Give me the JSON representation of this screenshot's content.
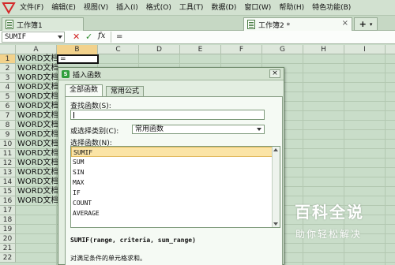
{
  "menubar": {
    "app_icon": "wps-spreadsheet-logo",
    "items": [
      "文件(F)",
      "编辑(E)",
      "视图(V)",
      "插入(I)",
      "格式(O)",
      "工具(T)",
      "数据(D)",
      "窗口(W)",
      "帮助(H)",
      "特色功能(B)"
    ]
  },
  "tabs": [
    {
      "label": "工作簿1",
      "active": false
    },
    {
      "label": "工作簿2 *",
      "active": true
    }
  ],
  "add_tab": {
    "label": "+"
  },
  "formula_bar": {
    "name_box": "SUMIF",
    "cancel": "✕",
    "enter": "✓",
    "fx": "fx",
    "content": "="
  },
  "grid": {
    "columns": [
      "A",
      "B",
      "C",
      "D",
      "E",
      "F",
      "G",
      "H",
      "I"
    ],
    "rows": [
      "1",
      "2",
      "3",
      "4",
      "5",
      "6",
      "7",
      "8",
      "9",
      "10",
      "11",
      "12",
      "13",
      "14",
      "15",
      "16",
      "17",
      "18",
      "19",
      "20",
      "21",
      "22"
    ],
    "column_a_values": [
      "WORD文档",
      "WORD文档",
      "WORD文档",
      "WORD文档",
      "WORD文档",
      "WORD文档",
      "WORD文档",
      "WORD文档",
      "WORD文档",
      "WORD文档",
      "WORD文档",
      "WORD文档",
      "WORD文档",
      "WORD文档",
      "WORD文档",
      "WORD文档"
    ],
    "active_cell_content": "="
  },
  "dialog": {
    "title": "插入函数",
    "close": "×",
    "tabs": [
      "全部函数",
      "常用公式"
    ],
    "search_label": "查找函数(S):",
    "search_value": "",
    "category_label": "或选择类别(C):",
    "category_value": "常用函数",
    "list_label": "选择函数(N):",
    "functions": [
      "SUMIF",
      "SUM",
      "SIN",
      "MAX",
      "IF",
      "COUNT",
      "AVERAGE"
    ],
    "selected_function": "SUMIF",
    "syntax": "SUMIF(range, criteria, sum_range)",
    "description": "对满足条件的单元格求和。"
  },
  "watermark": {
    "title": "百科全说",
    "subtitle": "助你轻松解决"
  },
  "colors": {
    "sheet_bg": "#c9ddc9",
    "selection_header": "#f2d28c",
    "selected_item": "#fbe4a6",
    "wps_red": "#d42a2a"
  }
}
